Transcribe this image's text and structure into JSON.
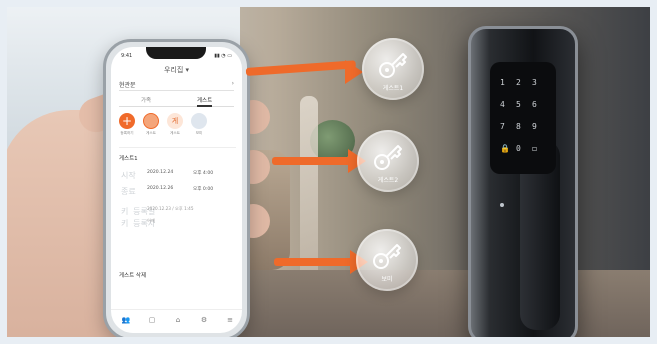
{
  "phone": {
    "status_time": "9:41",
    "status_icons": "▮▮ ◔ ▭",
    "header": "우리집",
    "header_arrow": "▾",
    "dropdown_value": "현관문",
    "dropdown_arrow": "›",
    "tabs": [
      {
        "label": "가족"
      },
      {
        "label": "게스트"
      }
    ],
    "avatars": [
      {
        "label": "등록하기",
        "glyph": "+"
      },
      {
        "label": "게스트"
      },
      {
        "label": "게스트",
        "glyph": "게"
      },
      {
        "label": "보미"
      }
    ],
    "card": {
      "title": "게스트1",
      "start_label": "시작",
      "start_date": "2020.12.24",
      "start_time": "오후 4:00",
      "end_label": "종료",
      "end_date": "2020.12.26",
      "end_time": "오후 0:00",
      "meta1_label": "키 등록일",
      "meta1_value": "2020.12.23 / 오후 1:45",
      "meta2_label": "키 등록자",
      "meta2_value": "이재"
    },
    "delete_label": "게스트 삭제"
  },
  "keys": [
    {
      "label": "게스트1"
    },
    {
      "label": "게스트2"
    },
    {
      "label": "보미"
    }
  ],
  "lock_keypad": [
    "1",
    "2",
    "3",
    "4",
    "5",
    "6",
    "7",
    "8",
    "9",
    "0"
  ],
  "colors": {
    "accent": "#ef6a2a",
    "lock": "#111316",
    "phone_bg": "#ffffff"
  }
}
